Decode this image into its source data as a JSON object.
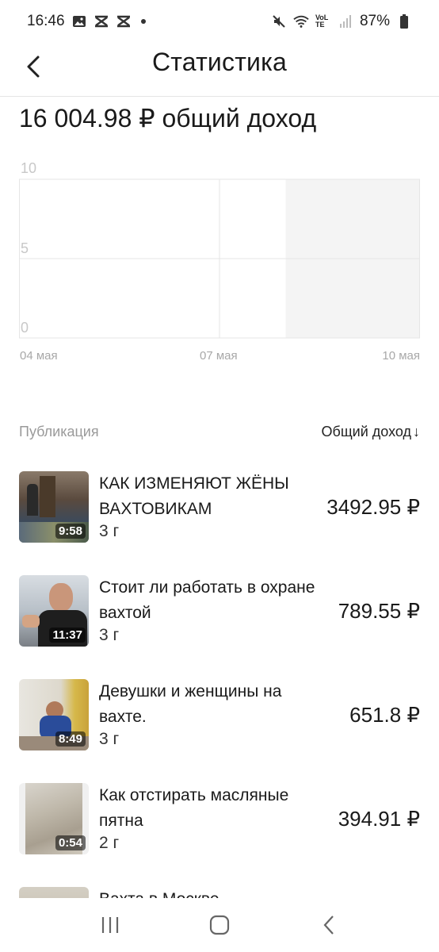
{
  "status_bar": {
    "time": "16:46",
    "battery": "87%",
    "network": "VoLTE"
  },
  "header": {
    "title": "Статистика"
  },
  "summary": {
    "total_income": "16 004.98 ₽ общий доход"
  },
  "chart_data": {
    "type": "bar",
    "y_ticks": [
      "10",
      "5",
      "0"
    ],
    "x_ticks": [
      "04 мая",
      "07 мая",
      "10 мая"
    ],
    "ylim": [
      0,
      10
    ],
    "grid": true,
    "values": [],
    "shaded_region": "08 мая – 10 мая"
  },
  "table": {
    "col_publication": "Публикация",
    "col_income": "Общий доход",
    "sort_arrow": "↓"
  },
  "rows": [
    {
      "title": "КАК ИЗМЕНЯЮТ ЖЁНЫ ВАХТОВИКАМ",
      "age": "3 г",
      "duration": "9:58",
      "income": "3492.95 ₽"
    },
    {
      "title": "Стоит ли работать в охране вахтой",
      "age": "3 г",
      "duration": "11:37",
      "income": "789.55 ₽"
    },
    {
      "title": "Девушки и женщины на вахте.",
      "age": "3 г",
      "duration": "8:49",
      "income": "651.8 ₽"
    },
    {
      "title": "Как отстирать масляные пятна",
      "age": "2 г",
      "duration": "0:54",
      "income": "394.91 ₽"
    },
    {
      "title": "Вахта в Москве"
    }
  ],
  "colors": {
    "text": "#1a1a1a",
    "muted": "#9a9a9a",
    "grid": "#e6e6e6",
    "shade": "#f4f4f4"
  }
}
